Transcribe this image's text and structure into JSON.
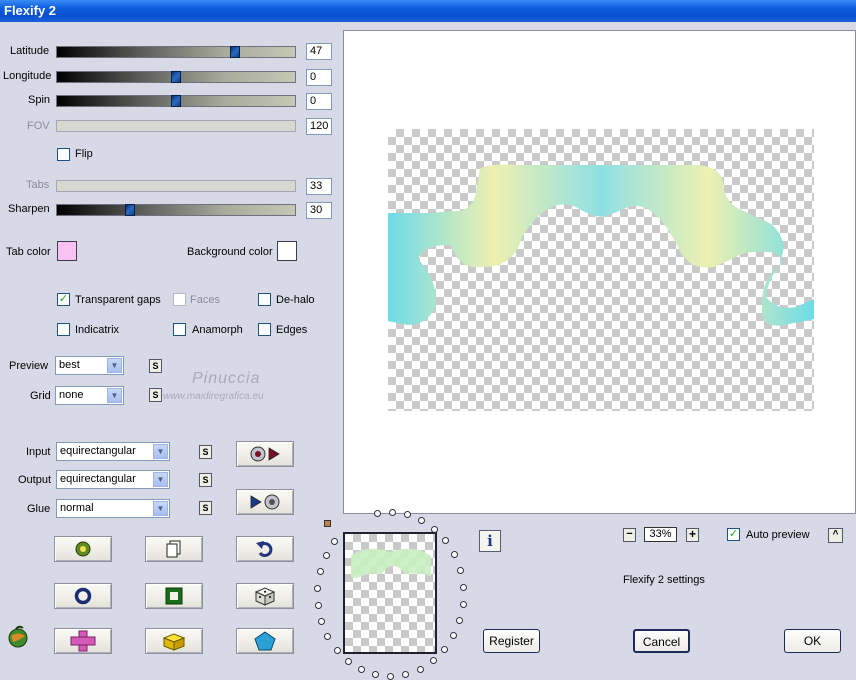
{
  "window": {
    "title": "Flexify 2"
  },
  "sliders": {
    "latitude": {
      "label": "Latitude",
      "value": "47"
    },
    "longitude": {
      "label": "Longitude",
      "value": "0"
    },
    "spin": {
      "label": "Spin",
      "value": "0"
    },
    "fov": {
      "label": "FOV",
      "value": "120"
    },
    "tabs": {
      "label": "Tabs",
      "value": "33"
    },
    "sharpen": {
      "label": "Sharpen",
      "value": "30"
    }
  },
  "flip": {
    "label": "Flip",
    "checked": false
  },
  "colors": {
    "tab_color_label": "Tab color",
    "tab_color": "#f9c2f2",
    "background_color_label": "Background color",
    "background_color": "#ffffff"
  },
  "options": {
    "transparent_gaps": {
      "label": "Transparent gaps",
      "checked": true
    },
    "faces": {
      "label": "Faces",
      "checked": false
    },
    "de_halo": {
      "label": "De-halo",
      "checked": false
    },
    "indicatrix": {
      "label": "Indicatrix",
      "checked": false
    },
    "anamorph": {
      "label": "Anamorph",
      "checked": false
    },
    "edges": {
      "label": "Edges",
      "checked": false
    }
  },
  "dropdowns": {
    "preview": {
      "label": "Preview",
      "value": "best"
    },
    "grid": {
      "label": "Grid",
      "value": "none"
    },
    "input": {
      "label": "Input",
      "value": "equirectangular"
    },
    "output": {
      "label": "Output",
      "value": "equirectangular"
    },
    "glue": {
      "label": "Glue",
      "value": "normal"
    }
  },
  "s_button_label": "S",
  "watermark": {
    "line1": "Pinuccia",
    "line2": "www.maidiregrafica.eu"
  },
  "zoom": {
    "value": "33%",
    "minus": "−",
    "plus": "+"
  },
  "auto_preview": {
    "label": "Auto preview",
    "checked": true
  },
  "settings_label": "Flexify 2 settings",
  "buttons": {
    "register": "Register",
    "cancel": "Cancel",
    "ok": "OK"
  },
  "info_label": "i",
  "collapse_label": "^",
  "icons": {
    "tools": [
      "randomize-icon",
      "copy-icon",
      "undo-icon",
      "ring-icon",
      "frame-icon",
      "dice-icon",
      "plus-shape-icon",
      "cube-icon",
      "pentagon-icon"
    ],
    "mode": [
      "sphere-to-output-icon",
      "output-to-sphere-icon"
    ],
    "logo": "flexify-globe-icon"
  },
  "accent_color": "#0a4fd0"
}
